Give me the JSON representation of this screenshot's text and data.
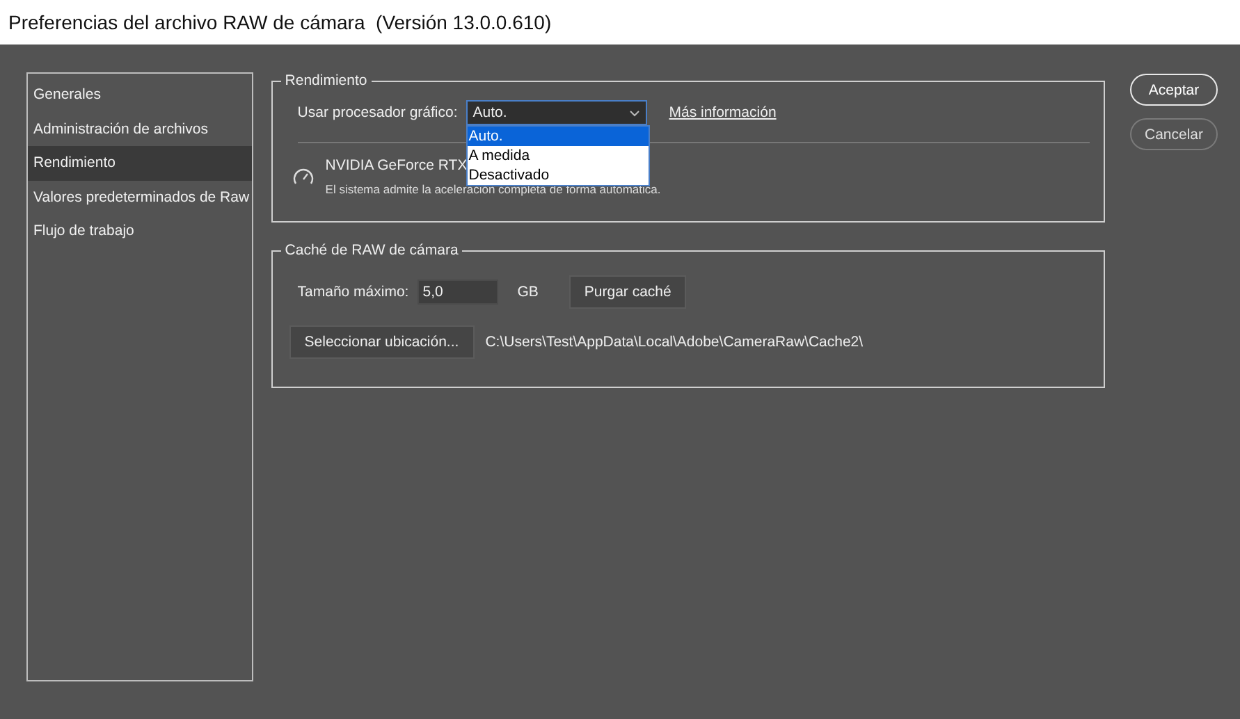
{
  "window": {
    "title": "Preferencias del archivo RAW de cámara  (Versión 13.0.0.610)"
  },
  "sidebar": {
    "items": [
      {
        "label": "Generales",
        "selected": false
      },
      {
        "label": "Administración de archivos",
        "selected": false
      },
      {
        "label": "Rendimiento",
        "selected": true
      },
      {
        "label": "Valores predeterminados de Raw",
        "selected": false
      },
      {
        "label": "Flujo de trabajo",
        "selected": false
      }
    ]
  },
  "performance": {
    "legend": "Rendimiento",
    "gpu_label": "Usar procesador gráfico:",
    "gpu_select": {
      "value": "Auto.",
      "expanded": true,
      "options": [
        {
          "label": "Auto.",
          "selected": true
        },
        {
          "label": "A medida",
          "selected": false
        },
        {
          "label": "Desactivado",
          "selected": false
        }
      ]
    },
    "more_info_link": "Más información",
    "gpu_name": "NVIDIA GeForce RTX",
    "gpu_status": "El sistema admite la aceleración completa de forma automática."
  },
  "cache": {
    "legend": "Caché de RAW de cámara",
    "max_size_label": "Tamaño máximo:",
    "max_size_value": "5,0",
    "unit": "GB",
    "purge_button": "Purgar caché",
    "select_location_button": "Seleccionar ubicación...",
    "path": "C:\\Users\\Test\\AppData\\Local\\Adobe\\CameraRaw\\Cache2\\"
  },
  "buttons": [
    {
      "label": "Aceptar",
      "kind": "primary"
    },
    {
      "label": "Cancelar",
      "kind": "secondary"
    }
  ]
}
